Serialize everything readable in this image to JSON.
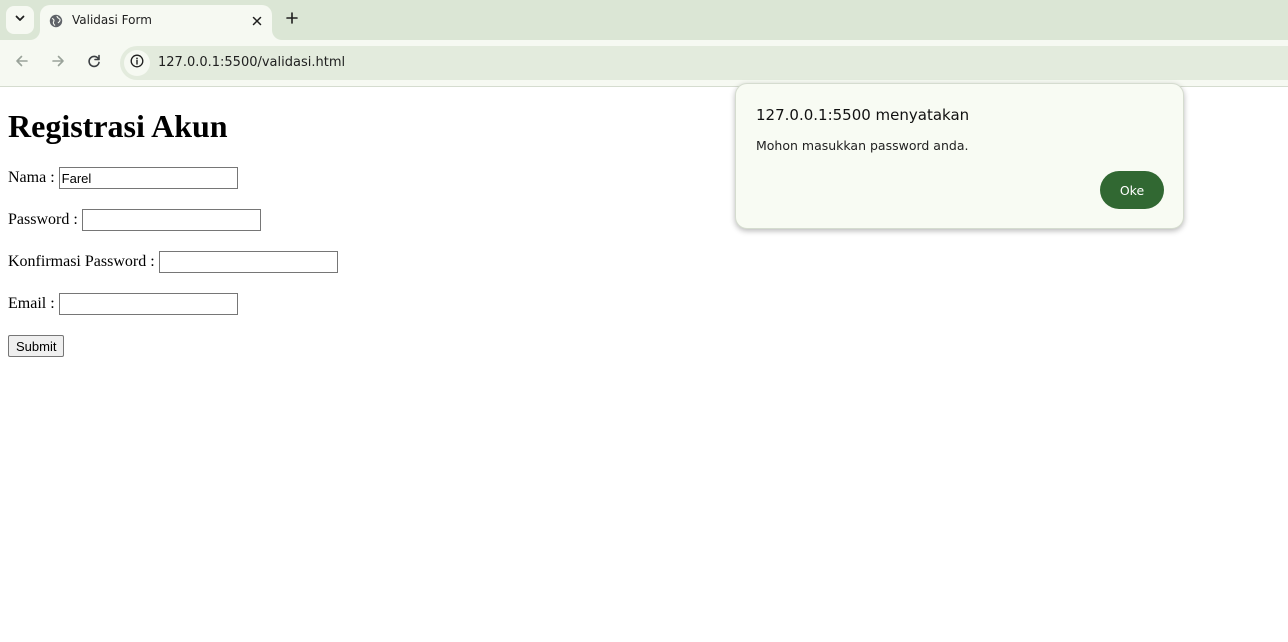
{
  "browser": {
    "tab": {
      "title": "Validasi Form"
    },
    "address_bar": {
      "url": "127.0.0.1:5500/validasi.html"
    },
    "icons": {
      "tab_search": "chevron-down-icon",
      "favicon": "globe-icon",
      "tab_close": "close-icon",
      "new_tab": "plus-icon",
      "back": "arrow-left-icon",
      "forward": "arrow-right-icon",
      "reload": "reload-icon",
      "site_info": "info-icon"
    },
    "colors": {
      "tabstrip": "#dbe6d5",
      "toolbar": "#f6f9f2",
      "omnibox": "#e3ebdd"
    }
  },
  "page": {
    "heading": "Registrasi Akun",
    "form": {
      "fields": [
        {
          "label": "Nama :",
          "value": "Farel"
        },
        {
          "label": "Password :",
          "value": ""
        },
        {
          "label": "Konfirmasi Password :",
          "value": ""
        },
        {
          "label": "Email :",
          "value": ""
        }
      ],
      "submit_label": "Submit"
    }
  },
  "dialog": {
    "title": "127.0.0.1:5500 menyatakan",
    "message": "Mohon masukkan password anda.",
    "ok_label": "Oke",
    "colors": {
      "background": "#f8fbf3",
      "button": "#316832"
    }
  }
}
